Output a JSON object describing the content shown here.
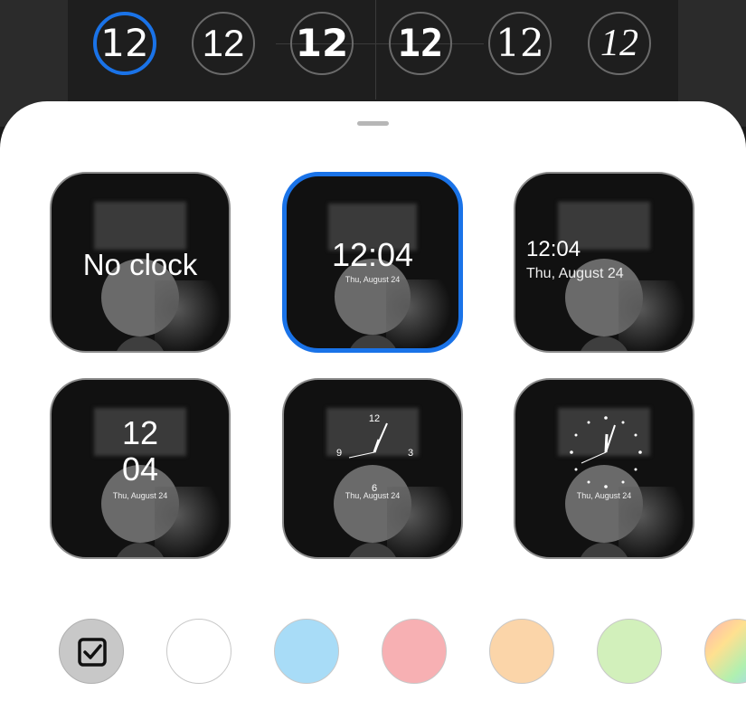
{
  "font_options": [
    {
      "label": "12",
      "selected": true
    },
    {
      "label": "12",
      "selected": false
    },
    {
      "label": "12",
      "selected": false
    },
    {
      "label": "12",
      "selected": false
    },
    {
      "label": "12",
      "selected": false
    },
    {
      "label": "12",
      "selected": false
    }
  ],
  "clock_styles": [
    {
      "label": "No clock"
    },
    {
      "time": "12:04",
      "date": "Thu, August 24",
      "selected": true
    },
    {
      "time": "12:04",
      "date": "Thu, August 24"
    },
    {
      "hour": "12",
      "minute": "04",
      "date": "Thu, August 24"
    },
    {
      "dial_numbers": [
        "12",
        "3",
        "6",
        "9"
      ],
      "date": "Thu, August 24"
    },
    {
      "date": "Thu, August 24"
    }
  ],
  "color_swatches": [
    {
      "name": "customize",
      "color": "#c8c8c8",
      "icon": "checkbox-icon"
    },
    {
      "name": "white",
      "color": "#ffffff"
    },
    {
      "name": "blue",
      "color": "#a8dcf7"
    },
    {
      "name": "pink",
      "color": "#f7b0b3"
    },
    {
      "name": "peach",
      "color": "#fbd5a9"
    },
    {
      "name": "green",
      "color": "#d2f0bb"
    },
    {
      "name": "gradient",
      "color": "#f0c0a0"
    }
  ],
  "accent_color": "#1a73e8"
}
